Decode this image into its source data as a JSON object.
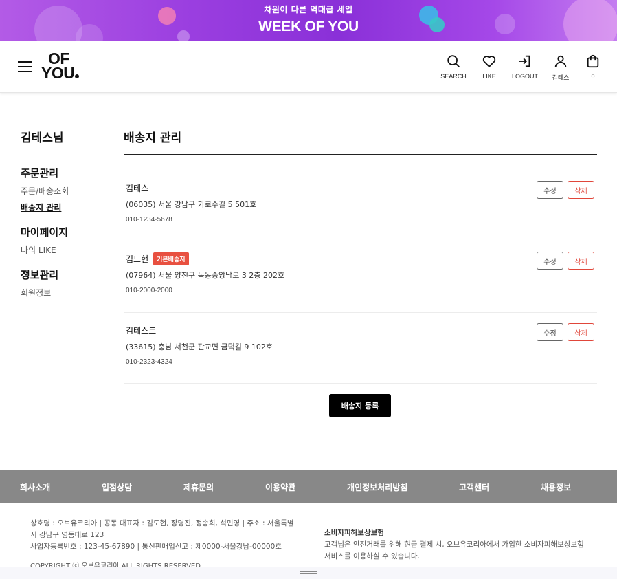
{
  "banner": {
    "subtitle": "차원이 다른 역대급 세일",
    "title": "WEEK OF YOU"
  },
  "header": {
    "logo_line1": "OF",
    "logo_line2": "YOU",
    "nav": {
      "search": "SEARCH",
      "like": "LIKE",
      "logout": "LOGOUT",
      "user": "김테스",
      "cart": "0"
    }
  },
  "sidebar": {
    "user_name": "김테스님",
    "groups": [
      {
        "title": "주문관리",
        "links": [
          "주문/배송조회",
          "배송지 관리"
        ]
      },
      {
        "title": "마이페이지",
        "links": [
          "나의 LIKE"
        ]
      },
      {
        "title": "정보관리",
        "links": [
          "회원정보"
        ]
      }
    ]
  },
  "main": {
    "title": "배송지 관리",
    "edit_label": "수정",
    "delete_label": "삭제",
    "default_badge": "기본배송지",
    "addresses": [
      {
        "name": "김테스",
        "address": "(06035) 서울 강남구 가로수길 5 501호",
        "phone": "010-1234-5678"
      },
      {
        "name": "김도현",
        "address": "(07964) 서울 양천구 목동중앙남로 3 2층 202호",
        "phone": "010-2000-2000"
      },
      {
        "name": "김테스트",
        "address": "(33615) 충남 서천군 판교면 금덕길 9 102호",
        "phone": "010-2323-4324"
      }
    ],
    "register_label": "배송지 등록"
  },
  "footer": {
    "nav": [
      "회사소개",
      "입점상담",
      "제휴문의",
      "이용약관",
      "개인정보처리방침",
      "고객센터",
      "채용정보"
    ],
    "company_info_1": "상호명 : 오브유코리아 | 공동 대표자 : 김도현, 장명진, 정송희, 석민영 | 주소 : 서울특별",
    "company_info_2": "시 강남구 영동대로 123",
    "company_info_3": "사업자등록번호 : 123-45-67890 | 통신판매업신고 : 제0000-서울강남-00000호",
    "insurance_title": "소비자피해보상보험",
    "insurance_text_1": "고객님은 안전거래를 위해 현금 결제 시, 오브유코리아에서 가입한 소비자피해보상보험",
    "insurance_text_2": "서비스를 이용하실 수 있습니다.",
    "copyright": "COPYRIGHT ⓒ 오브유코리아 ALL RIGHTS RESERVED"
  },
  "colors": {
    "banner_purple": "#9b3fe0",
    "badge_red": "#e85040",
    "delete_red": "#e0463a",
    "footer_gray": "#888888"
  }
}
